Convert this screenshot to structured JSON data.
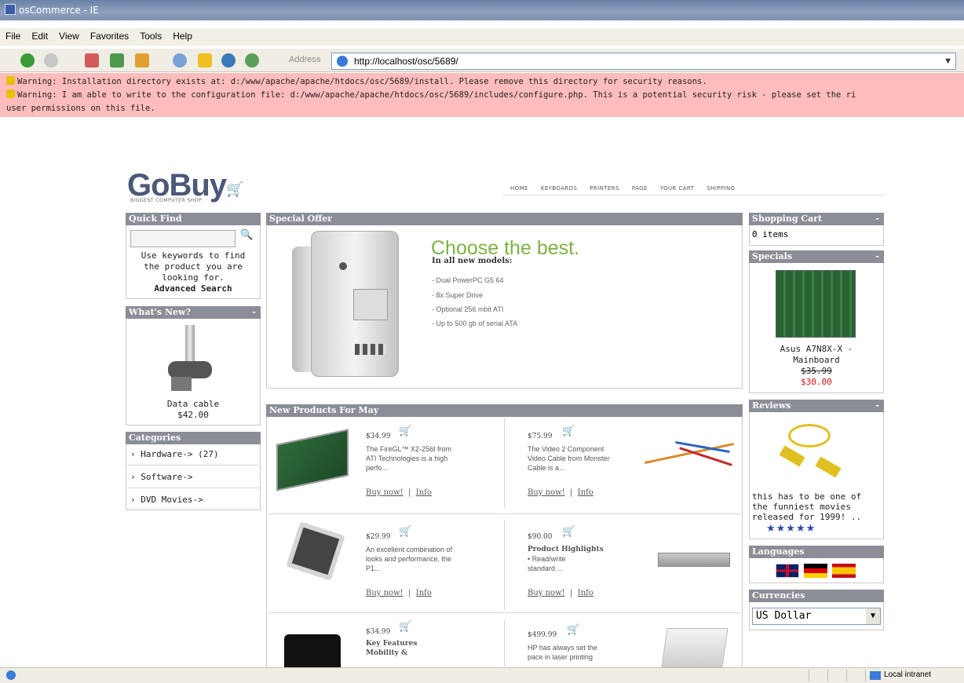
{
  "window": {
    "title": "osCommerce - IE"
  },
  "menu": [
    "File",
    "Edit",
    "View",
    "Favorites",
    "Tools",
    "Help"
  ],
  "toolbar": {
    "address_label": "Address",
    "url": "http://localhost/osc/5689/"
  },
  "warnings": [
    "Warning: Installation directory exists at: d:/www/apache/apache/htdocs/osc/5689/install. Please remove this directory for security reasons.",
    "Warning: I am able to write to the configuration file: d:/www/apache/apache/htdocs/osc/5689/includes/configure.php. This is a potential security risk - please set the ri",
    "user permissions on this file."
  ],
  "store": {
    "logo": "GoBuy",
    "tagline": "BIGGEST COMPUTER SHOP",
    "nav": [
      "HOME",
      "KEYBOARDS",
      "PRINTERS",
      "PAGE",
      "YOUR CART",
      "SHIPPING"
    ]
  },
  "quick_find": {
    "title": "Quick Find",
    "help": [
      "Use keywords to find",
      "the product you are",
      "looking for."
    ],
    "advanced": "Advanced Search"
  },
  "whats_new": {
    "title": "What's New?",
    "name": "Data cable",
    "price": "$42.00"
  },
  "categories": {
    "title": "Categories",
    "items": [
      "Hardware-> (27)",
      "Software->",
      "DVD Movies->"
    ]
  },
  "special_offer": {
    "title": "Special Offer",
    "headline": "Choose the best.",
    "subhead": "In all new models:",
    "bullets": [
      "- Dual PowerPC G5 64",
      "- 8x Super Drive",
      "- Optional 256 mbit ATI",
      "- Up to 500 gb of serial ATA"
    ]
  },
  "new_products": {
    "title": "New Products For May",
    "buy": "Buy now!",
    "info": "Info",
    "sep": "|",
    "items": [
      {
        "price": "$34.99",
        "desc": [
          "The FireGL™ X2-256t from",
          "ATI Technologies is a high",
          "perfo..."
        ]
      },
      {
        "price": "$75.99",
        "desc": [
          "The Video 2 Component",
          "Video Cable from Monster",
          "Cable is a..."
        ]
      },
      {
        "price": "$29.99",
        "desc": [
          "An excellent combination of",
          "looks and performance, the",
          "P1..."
        ]
      },
      {
        "price": "$90.00",
        "desc": [
          "Product Highlights",
          "• Read/write",
          "standard ..."
        ]
      },
      {
        "price": "$34.99",
        "desc": [
          "Key Features",
          "",
          "Mobility &"
        ]
      },
      {
        "price": "$499.99",
        "desc": [
          "HP has always set the",
          "pace in laser printing",
          ""
        ]
      }
    ]
  },
  "shopping_cart": {
    "title": "Shopping Cart",
    "content": "0 items"
  },
  "specials": {
    "title": "Specials",
    "name": [
      "Asus A7N8X-X -",
      "Mainboard"
    ],
    "old_price": "$35.99",
    "new_price": "$30.00"
  },
  "reviews": {
    "title": "Reviews",
    "text": [
      "this has to be one of",
      "the funniest movies",
      "released for 1999! .."
    ],
    "stars": "★★★★★"
  },
  "languages": {
    "title": "Languages"
  },
  "currencies": {
    "title": "Currencies",
    "selected": "US Dollar"
  },
  "statusbar": {
    "zone": "Local intranet"
  }
}
